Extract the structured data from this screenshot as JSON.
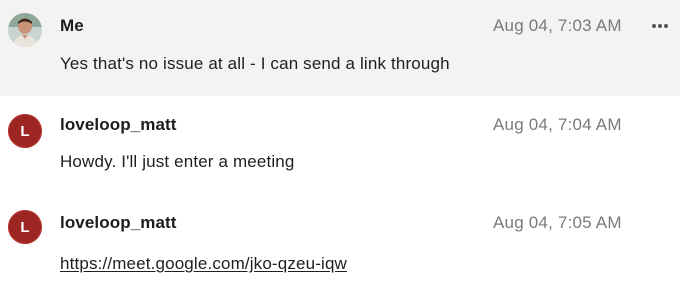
{
  "messages": [
    {
      "author": "Me",
      "timestamp": "Aug 04, 7:03 AM",
      "text": "Yes that's no issue at all - I can send a link through",
      "avatar_icon": "user-photo-icon",
      "hovered": true
    },
    {
      "author": "loveloop_matt",
      "timestamp": "Aug 04, 7:04 AM",
      "text": "Howdy. I'll just enter a meeting",
      "avatar_letter": "L",
      "avatar_color": "#9e2622"
    },
    {
      "author": "loveloop_matt",
      "timestamp": "Aug 04, 7:05 AM",
      "link_text": "https://meet.google.com/jko-qzeu-iqw",
      "avatar_letter": "L",
      "avatar_color": "#9e2622"
    }
  ],
  "actions": {
    "more_icon": "more-horizontal-icon"
  }
}
